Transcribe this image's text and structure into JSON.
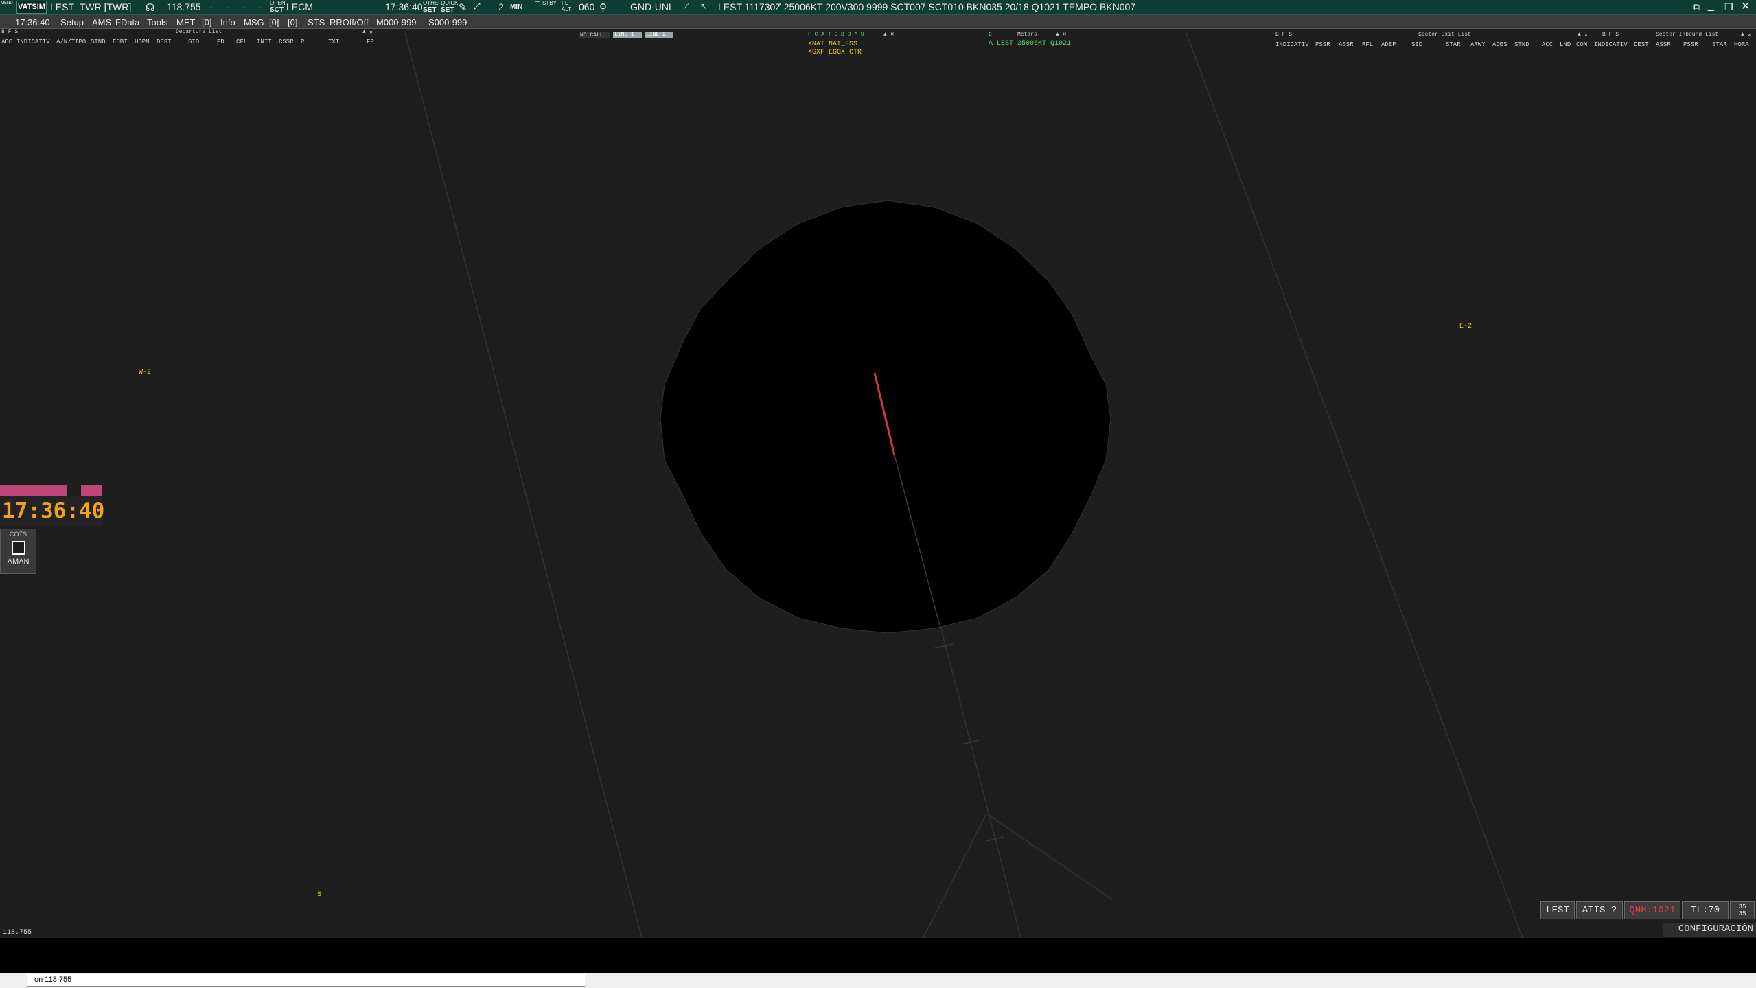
{
  "topbar": {
    "menu_label": "MENU",
    "logo": "VATSIM",
    "position": "LEST_TWR [TWR]",
    "frequency": "118.755",
    "dashes": [
      "-",
      "-",
      "-",
      "-"
    ],
    "open_label": "OPEN",
    "sct_label": "SCT",
    "sector": "LECM",
    "time": "17:36:40",
    "other_label": "OTHER",
    "set_label": "SET",
    "quick_label": "QUICK",
    "set2_label": "SET",
    "range_value": "2",
    "min_label": "MIN",
    "stby_label": "STBY",
    "fl_label": "FL",
    "alt_label": "ALT",
    "alt_value": "060",
    "filter": "GND-UNL",
    "metar": "LEST 111730Z 25006KT 200V300 9999 SCT007 SCT010 BKN035 20/18 Q1021 TEMPO BKN007"
  },
  "menubar": {
    "time": "17:36:40",
    "items": [
      "Setup",
      "AMS",
      "FData",
      "Tools",
      "MET",
      "[0]",
      "Info",
      "MSG",
      "[0]",
      "[0]",
      "STS",
      "RROff/Off",
      "M000-999",
      "S000-999"
    ]
  },
  "departure_list": {
    "controls": "B F S",
    "title": "Departure List",
    "columns": [
      "ACC",
      "INDICATIV",
      "A/N/TIPO",
      "STND",
      "EOBT",
      "HOPM",
      "DEST",
      "SID",
      "PD",
      "CFL",
      "INIT",
      "CSSR",
      "R",
      "TXT",
      "FP"
    ]
  },
  "call_panel": {
    "no_call": "NO CALL",
    "line1": "LINE 1",
    "line2": "LINE 2"
  },
  "atc_panel": {
    "controls": "F C A T G B D * U",
    "entries": [
      "<NAT NAT_FSS",
      "<GXF EGGX_CTR"
    ]
  },
  "metars_panel": {
    "controls": "C",
    "title": "Metars",
    "entry": "A LEST 25006KT Q1021"
  },
  "sector_exit_list": {
    "controls": "B F S",
    "title": "Sector Exit List",
    "columns": [
      "INDICATIV",
      "PSSR",
      "ASSR",
      "RFL",
      "ADEP",
      "SID",
      "STAR",
      "ARWY",
      "ADES",
      "STND",
      "ACC"
    ]
  },
  "sector_inbound_list": {
    "controls": "B F S",
    "title": "Sector Inbound List",
    "columns": [
      "LND",
      "COM",
      "INDICATIV",
      "DEST",
      "ASSR",
      "PSSR",
      "STAR",
      "HORA"
    ]
  },
  "map": {
    "labels": {
      "west": "W-2",
      "east": "E-2",
      "south": "S"
    },
    "colors": {
      "background": "#1e1e1e",
      "circle": "#000000",
      "runway": "#d03838",
      "lines": "#333333"
    }
  },
  "clock": {
    "time": "17:36:40"
  },
  "aman": {
    "cots_label": "COTS",
    "label": "AMAN"
  },
  "status": {
    "airport": "LEST",
    "atis": "ATIS ?",
    "qnh": "QNH:1021",
    "transition_level": "TL:70",
    "runway_top": "35",
    "runway_bottom": "35",
    "config": "CONFIGURACIÓN"
  },
  "bottom": {
    "frequency": "118.755",
    "command_text": "on 118.755"
  }
}
